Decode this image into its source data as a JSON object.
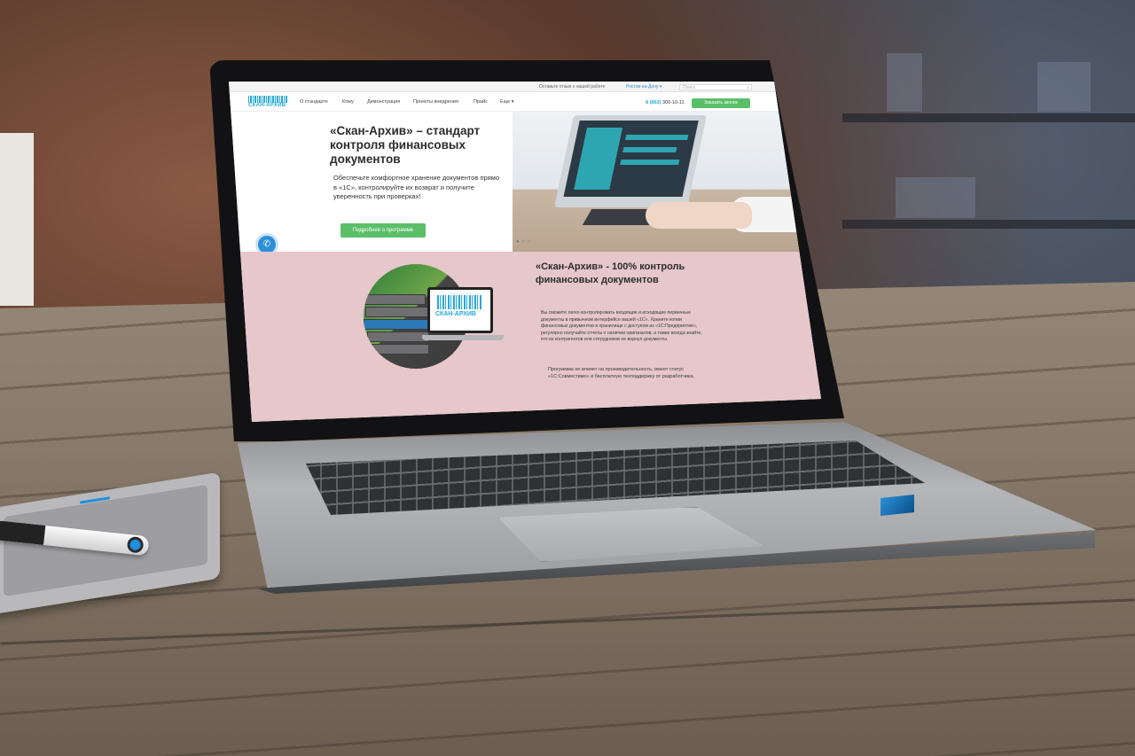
{
  "site": {
    "topbar": {
      "feedback": "Оставьте отзыв о нашей работе",
      "city": "Ростов-на-Дону ▾",
      "search_placeholder": "Поиск"
    },
    "logo_text": "СКАН-АРХИВ",
    "nav": [
      "О стандарте",
      "Кому",
      "Демонстрация",
      "Проекты внедрения",
      "Прайс",
      "Еще ▾"
    ],
    "phone_prefix": "8 (863)",
    "phone_number": "300-10-11",
    "callback_label": "Заказать звонок",
    "hero": {
      "title": "«Скан-Архив» – стандарт контроля финансовых документов",
      "text": "Обеспечьте комфортное хранение документов прямо в «1С», контролируйте их возврат и получите уверенность при проверках!",
      "button": "Подробнее о программе",
      "dots": "●○○"
    },
    "section2": {
      "title": "«Скан-Архив» - 100% контроль финансовых документов",
      "text": "Вы сможете легко контролировать входящие и исходящие первичные документы в привычном интерфейсе вашей «1С». Храните копии финансовых документов в хранилище с доступом из «1С:Предприятие», регулярно получайте отчеты о наличии оригиналов, а также всегда знайте, кто из контрагентов или сотрудников не вернул документы.",
      "note": "Программа не влияет на производительность, имеет статус «1С:Совместимо» и бесплатную техподдержку от разработчика.",
      "logo_text": "СКАН-АРХИВ"
    }
  },
  "colors": {
    "accent_green": "#5bbf6a",
    "accent_blue": "#27a9d9",
    "section_pink": "#e6c7cb"
  },
  "icons": [
    "phone-icon",
    "chat-icon",
    "search-icon"
  ]
}
